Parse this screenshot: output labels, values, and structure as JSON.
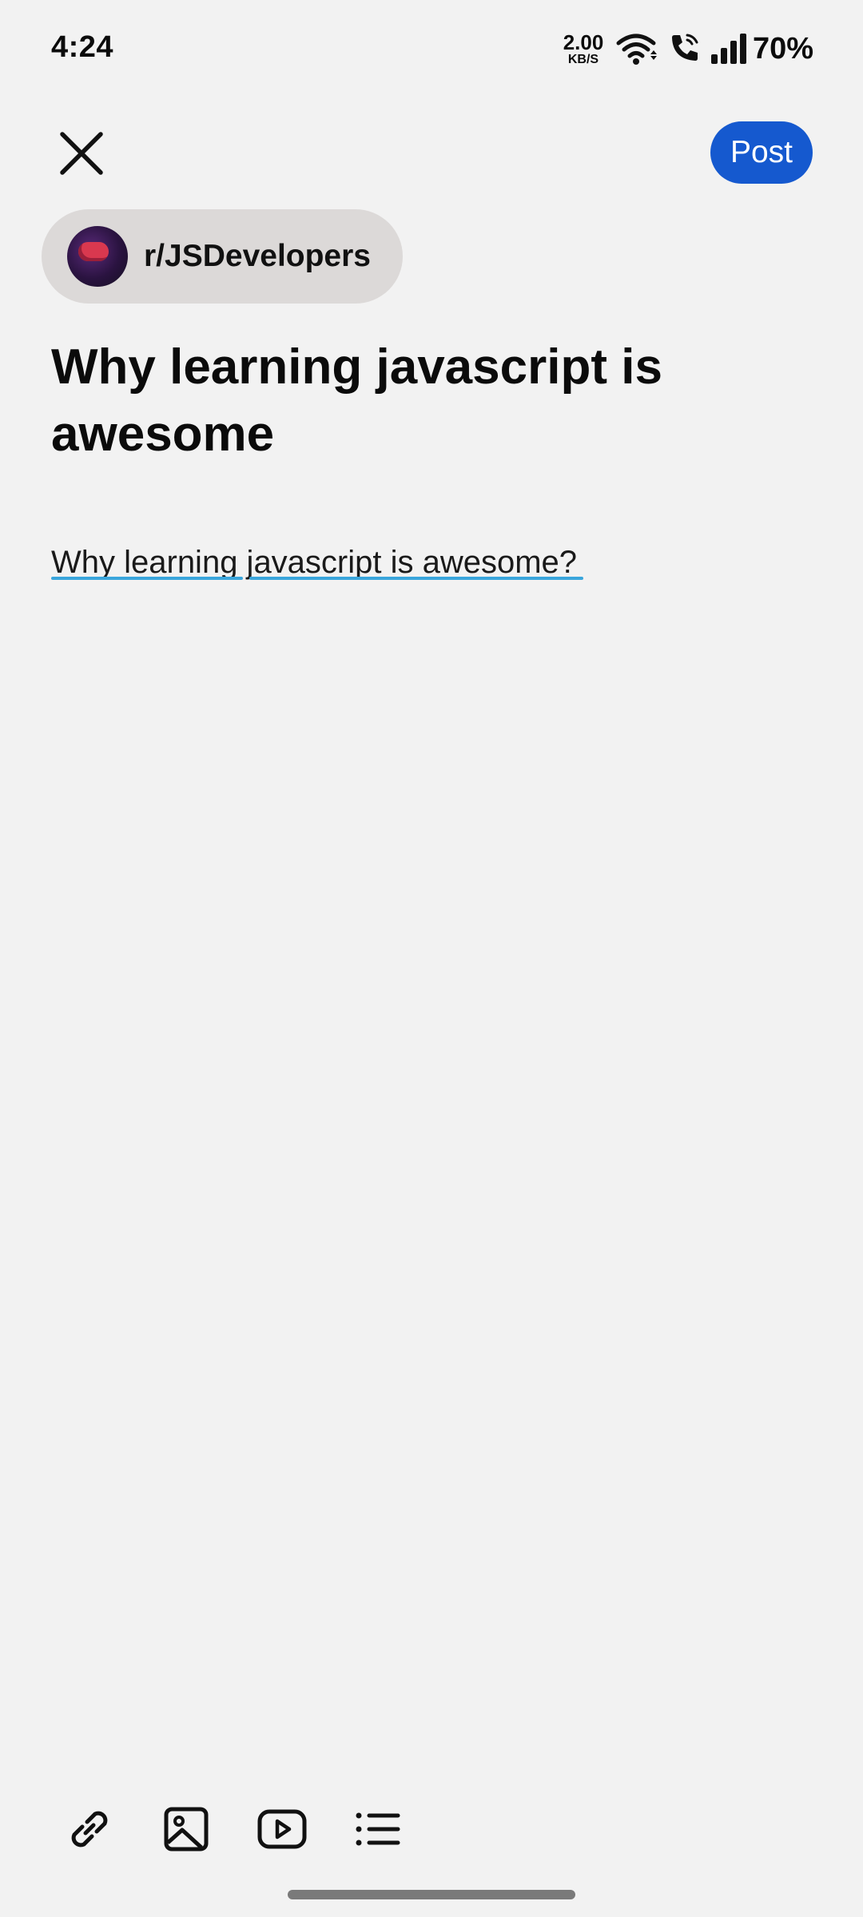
{
  "status_bar": {
    "time": "4:24",
    "net_speed_value": "2.00",
    "net_speed_unit": "KB/S",
    "battery": "70%"
  },
  "header": {
    "close_icon": "close-icon",
    "post_label": "Post"
  },
  "community": {
    "name": "r/JSDevelopers"
  },
  "post": {
    "title": "Why learning javascript is awesome",
    "body": "Why learning javascript is awesome?"
  },
  "toolbar": {
    "items": [
      "link-icon",
      "image-icon",
      "video-icon",
      "list-icon"
    ]
  },
  "colors": {
    "accent": "#1559cf",
    "background": "#f2f2f2",
    "chip": "#dcd9d8",
    "spellcheck": "#3aa6dc"
  }
}
